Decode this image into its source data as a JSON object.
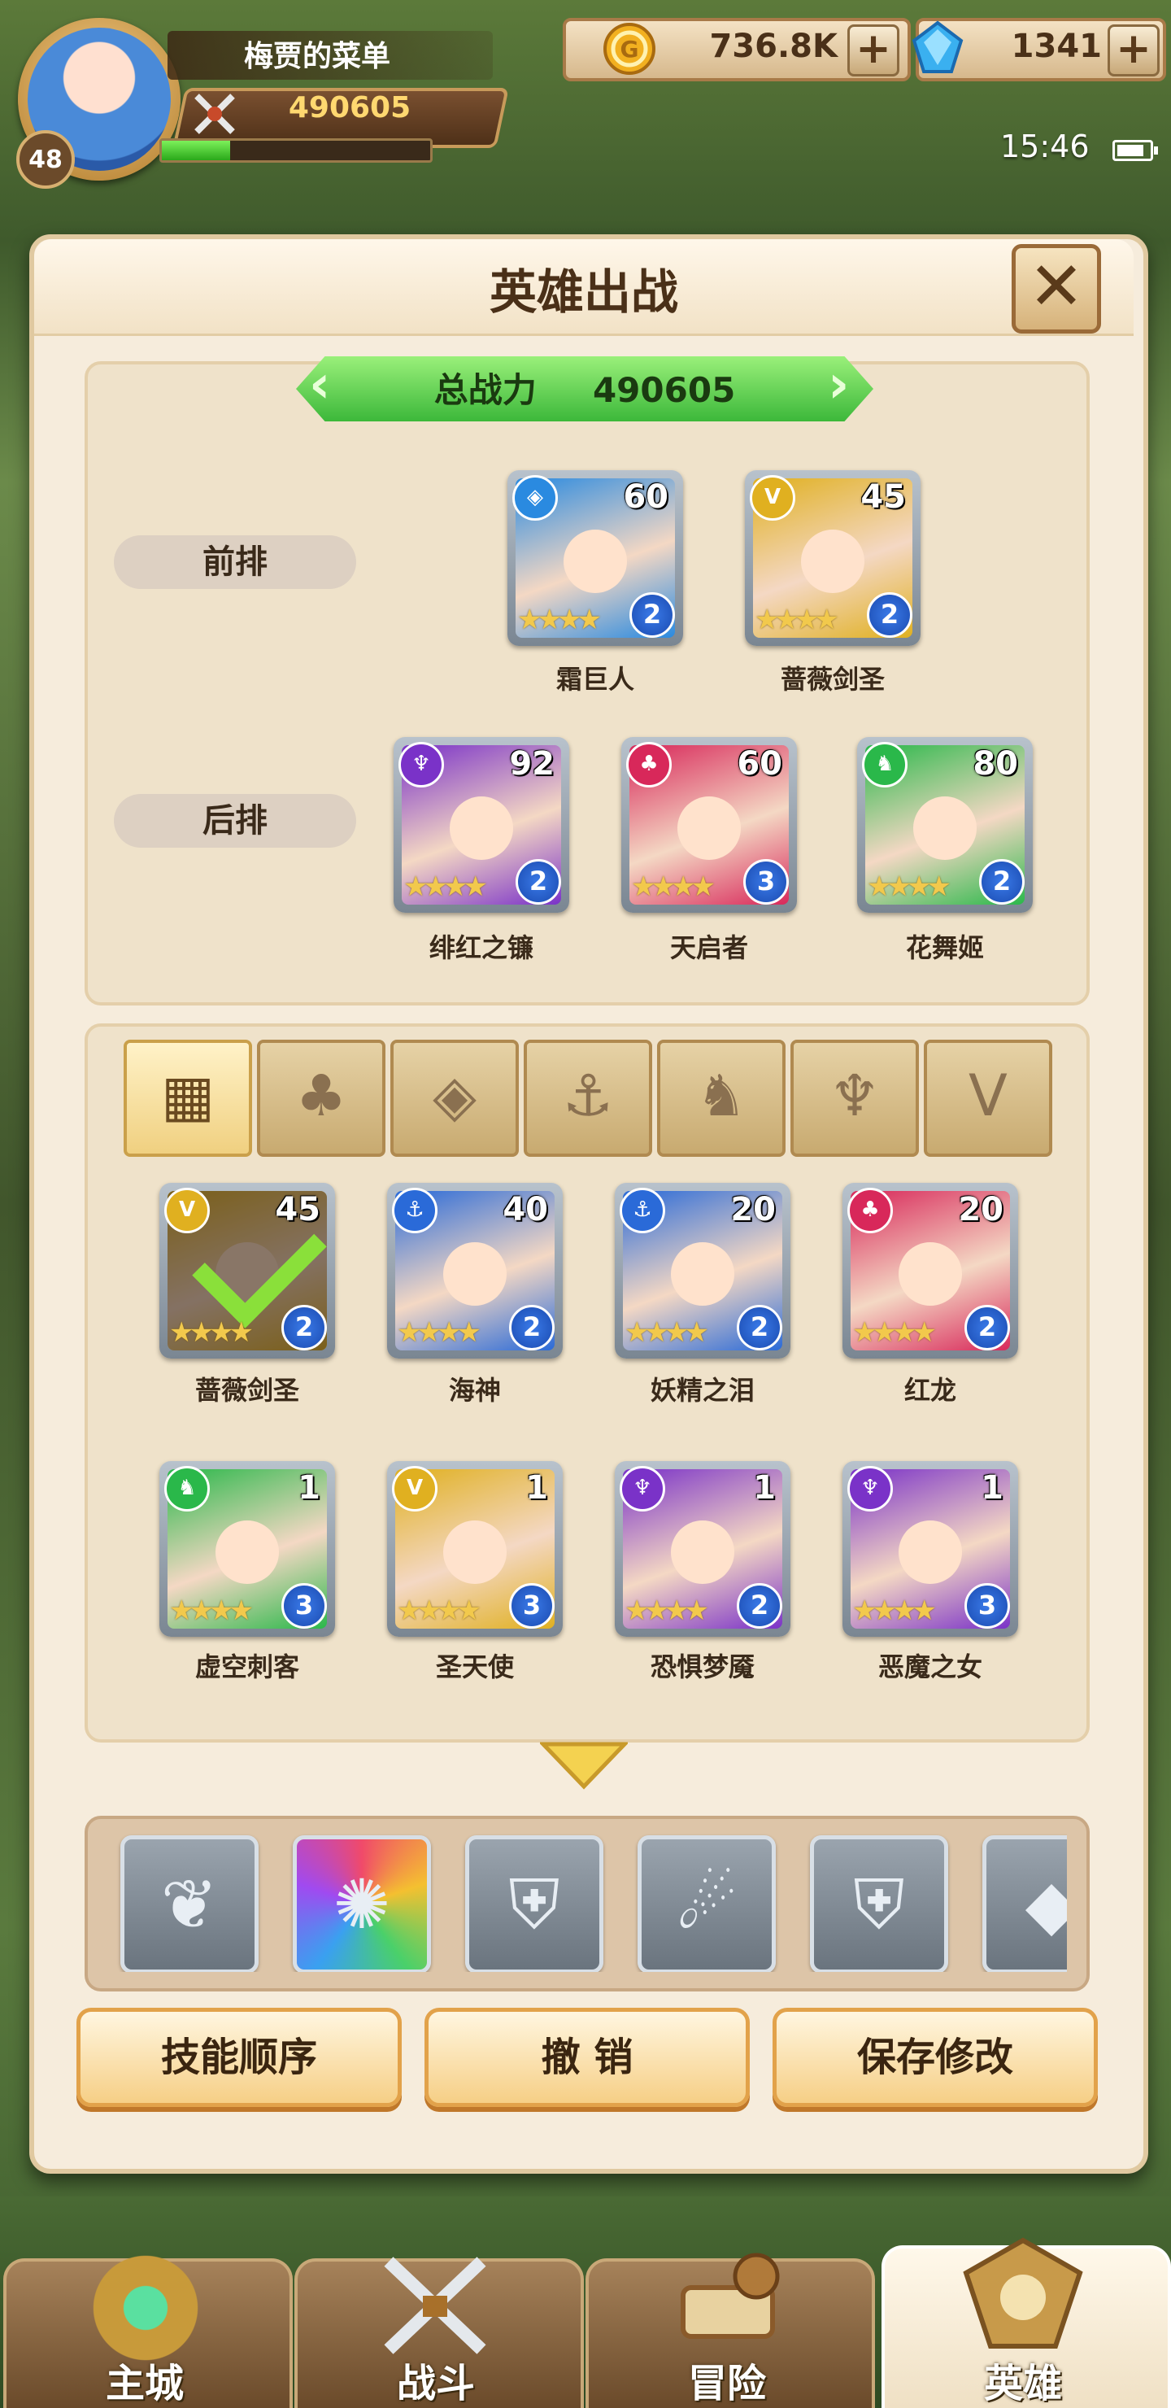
{
  "player": {
    "name": "梅贾的菜单",
    "level": "48",
    "power": "490605",
    "exp_fraction": 0.26
  },
  "currency": {
    "gold": "736.8K",
    "gems": "1341",
    "plus": "+"
  },
  "status": {
    "time": "15:46",
    "battery_level": 0.85
  },
  "panel": {
    "title": "英雄出战",
    "close": "✕"
  },
  "total_power": {
    "label": "总战力",
    "value": "490605"
  },
  "formation": {
    "front_label": "前排",
    "back_label": "后排",
    "front": [
      {
        "name": "霜巨人",
        "level": "60",
        "grade": "2",
        "faction": "diamond",
        "color": "#2a8ae0"
      },
      {
        "name": "蔷薇剑圣",
        "level": "45",
        "grade": "2",
        "faction": "chevron",
        "color": "#e0b020"
      }
    ],
    "back": [
      {
        "name": "绯红之镰",
        "level": "92",
        "grade": "2",
        "faction": "horns",
        "color": "#7a32c8"
      },
      {
        "name": "天启者",
        "level": "60",
        "grade": "3",
        "faction": "flame",
        "color": "#d8285a"
      },
      {
        "name": "花舞姬",
        "level": "80",
        "grade": "2",
        "faction": "beast",
        "color": "#2ab84a"
      }
    ]
  },
  "filters": [
    "all-grid",
    "flame",
    "diamond",
    "anchor",
    "beast",
    "horns",
    "chevron"
  ],
  "roster": [
    {
      "name": "蔷薇剑圣",
      "level": "45",
      "grade": "2",
      "faction": "chevron",
      "color": "#e0b020",
      "selected": true
    },
    {
      "name": "海神",
      "level": "40",
      "grade": "2",
      "faction": "anchor",
      "color": "#2a6ad8",
      "selected": false
    },
    {
      "name": "妖精之泪",
      "level": "20",
      "grade": "2",
      "faction": "anchor",
      "color": "#2a6ad8",
      "selected": false
    },
    {
      "name": "红龙",
      "level": "20",
      "grade": "2",
      "faction": "flame",
      "color": "#d8285a",
      "selected": false
    },
    {
      "name": "虚空刺客",
      "level": "1",
      "grade": "3",
      "faction": "beast",
      "color": "#2ab84a",
      "selected": false
    },
    {
      "name": "圣天使",
      "level": "1",
      "grade": "3",
      "faction": "chevron",
      "color": "#e0b020",
      "selected": false
    },
    {
      "name": "恐惧梦魇",
      "level": "1",
      "grade": "2",
      "faction": "horns",
      "color": "#7a32c8",
      "selected": false
    },
    {
      "name": "恶魔之女",
      "level": "1",
      "grade": "3",
      "faction": "horns",
      "color": "#7a32c8",
      "selected": false
    }
  ],
  "skills": [
    "wing-emblem-icon",
    "rainbow-burst-icon",
    "shield-crest-icon",
    "phoenix-strike-icon",
    "shield-crest-icon",
    "crystal-shield-icon"
  ],
  "actions": {
    "skill_order": "技能顺序",
    "undo": "撤 销",
    "save": "保存修改"
  },
  "nav": {
    "main_city": "主城",
    "battle": "战斗",
    "adventure": "冒险",
    "heroes": "英雄"
  }
}
